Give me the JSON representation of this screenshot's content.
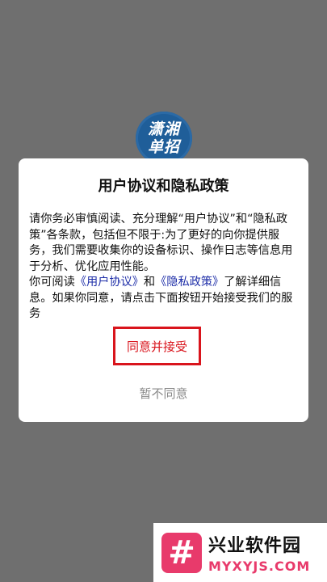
{
  "app": {
    "logo_line1": "潇湘",
    "logo_line2": "单招"
  },
  "dialog": {
    "title": "用户协议和隐私政策",
    "paragraph1": "请你务必审慎阅读、充分理解“用户协议”和“隐私政策”各条款，包括但不限于:为了更好的向你提供服务，我们需要收集你的设备标识、操作日志等信息用于分析、优化应用性能。",
    "paragraph2_prefix": "你可阅读",
    "user_agreement_link": "《用户协议》",
    "paragraph2_and": "和",
    "privacy_policy_link": "《隐私政策》",
    "paragraph2_suffix": "了解详细信息。如果你同意，请点击下面按钮开始接受我们的服务",
    "agree_label": "同意并接受",
    "disagree_label": "暂不同意"
  },
  "watermark": {
    "icon_glyph": "#",
    "title": "兴业软件园",
    "subtitle": "MYXYJS.COM"
  },
  "colors": {
    "accent_red": "#d9141c",
    "link_blue": "#1e2ea8",
    "logo_blue": "#1f5e99",
    "overlay_gray": "#6f6f6f"
  }
}
